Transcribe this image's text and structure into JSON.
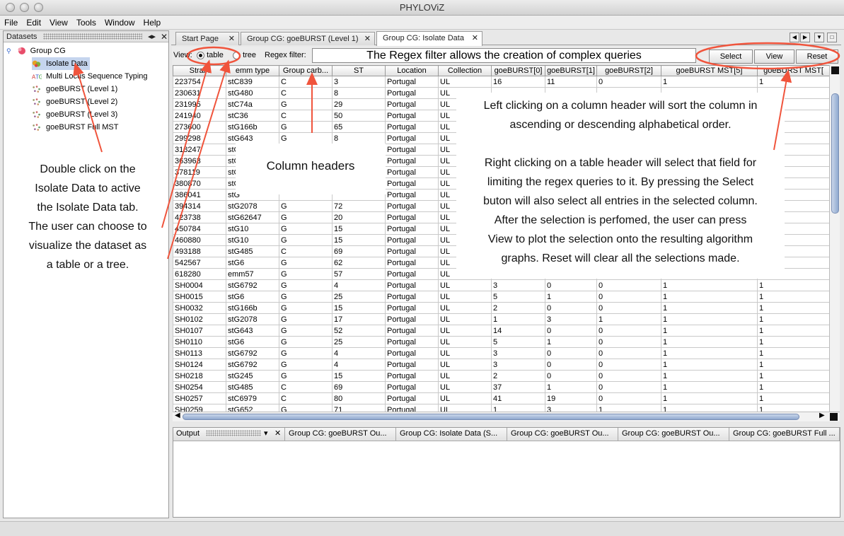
{
  "window": {
    "title": "PHYLOViZ"
  },
  "menu": [
    "File",
    "Edit",
    "View",
    "Tools",
    "Window",
    "Help"
  ],
  "datasets_panel": {
    "title": "Datasets",
    "root": "Group CG",
    "items": [
      {
        "label": "Isolate Data",
        "icon": "isolate-data-icon",
        "selected": true
      },
      {
        "label": "Multi Locus Sequence Typing",
        "icon": "mlst-icon"
      },
      {
        "label": "goeBURST (Level 1)",
        "icon": "goeburst-graph-icon"
      },
      {
        "label": "goeBURST (Level 2)",
        "icon": "goeburst-graph-icon"
      },
      {
        "label": "goeBURST (Level 3)",
        "icon": "goeburst-graph-icon"
      },
      {
        "label": "goeBURST Full MST",
        "icon": "goeburst-graph-icon"
      }
    ]
  },
  "tabs": [
    {
      "label": "Start Page"
    },
    {
      "label": "Group CG: goeBURST (Level 1)"
    },
    {
      "label": "Group CG: Isolate Data",
      "active": true
    }
  ],
  "viewbar": {
    "view_label": "View:",
    "table_label": "table",
    "tree_label": "tree",
    "regex_label": "Regex filter:",
    "regex_value": "The Regex filter allows the creation of complex queries",
    "select_label": "Select",
    "view_button_label": "View",
    "reset_label": "Reset",
    "selected_view": "table"
  },
  "table": {
    "columns": [
      "Strain",
      "emm type",
      "Group carb...",
      "ST",
      "Location",
      "Collection",
      "goeBURST[0]",
      "goeBURST[1]",
      "goeBURST[2]",
      "goeBURST MST[5]",
      "goeBURST MST["
    ],
    "rows": [
      [
        "223754",
        "stC839",
        "C",
        "3",
        "Portugal",
        "UL",
        "16",
        "11",
        "0",
        "1",
        "1"
      ],
      [
        "230631",
        "stG480",
        "C",
        "8",
        "Portugal",
        "UL",
        "",
        "",
        "",
        "",
        ""
      ],
      [
        "231995",
        "stC74a",
        "G",
        "29",
        "Portugal",
        "UL",
        "",
        "",
        "",
        "",
        ""
      ],
      [
        "241940",
        "stC36",
        "C",
        "50",
        "Portugal",
        "UL",
        "",
        "",
        "",
        "",
        ""
      ],
      [
        "273600",
        "stG166b",
        "G",
        "65",
        "Portugal",
        "UL",
        "",
        "",
        "",
        "",
        ""
      ],
      [
        "299298",
        "stG643",
        "G",
        "8",
        "Portugal",
        "UL",
        "",
        "",
        "",
        "",
        ""
      ],
      [
        "318247",
        "stG",
        "",
        "",
        "Portugal",
        "UL",
        "",
        "",
        "",
        "",
        ""
      ],
      [
        "363963",
        "stG",
        "",
        "",
        "Portugal",
        "UL",
        "",
        "",
        "",
        "",
        ""
      ],
      [
        "378119",
        "stG",
        "",
        "",
        "Portugal",
        "UL",
        "",
        "",
        "",
        "",
        ""
      ],
      [
        "380870",
        "stG",
        "",
        "",
        "Portugal",
        "UL",
        "",
        "",
        "",
        "",
        ""
      ],
      [
        "386041",
        "stG",
        "",
        "",
        "Portugal",
        "UL",
        "",
        "",
        "",
        "",
        ""
      ],
      [
        "394314",
        "stG2078",
        "G",
        "72",
        "Portugal",
        "UL",
        "",
        "",
        "",
        "",
        ""
      ],
      [
        "423738",
        "stG62647",
        "G",
        "20",
        "Portugal",
        "UL",
        "",
        "",
        "",
        "",
        ""
      ],
      [
        "450784",
        "stG10",
        "G",
        "15",
        "Portugal",
        "UL",
        "",
        "",
        "",
        "",
        ""
      ],
      [
        "460880",
        "stG10",
        "G",
        "15",
        "Portugal",
        "UL",
        "",
        "",
        "",
        "",
        ""
      ],
      [
        "493188",
        "stG485",
        "C",
        "69",
        "Portugal",
        "UL",
        "",
        "",
        "",
        "",
        ""
      ],
      [
        "542567",
        "stG6",
        "G",
        "62",
        "Portugal",
        "UL",
        "",
        "",
        "",
        "",
        ""
      ],
      [
        "618280",
        "emm57",
        "G",
        "57",
        "Portugal",
        "UL",
        "",
        "",
        "",
        "",
        ""
      ],
      [
        "SH0004",
        "stG6792",
        "G",
        "4",
        "Portugal",
        "UL",
        "3",
        "0",
        "0",
        "1",
        "1"
      ],
      [
        "SH0015",
        "stG6",
        "G",
        "25",
        "Portugal",
        "UL",
        "5",
        "1",
        "0",
        "1",
        "1"
      ],
      [
        "SH0032",
        "stG166b",
        "G",
        "15",
        "Portugal",
        "UL",
        "2",
        "0",
        "0",
        "1",
        "1"
      ],
      [
        "SH0102",
        "stG2078",
        "G",
        "17",
        "Portugal",
        "UL",
        "1",
        "3",
        "1",
        "1",
        "1"
      ],
      [
        "SH0107",
        "stG643",
        "G",
        "52",
        "Portugal",
        "UL",
        "14",
        "0",
        "0",
        "1",
        "1"
      ],
      [
        "SH0110",
        "stG6",
        "G",
        "25",
        "Portugal",
        "UL",
        "5",
        "1",
        "0",
        "1",
        "1"
      ],
      [
        "SH0113",
        "stG6792",
        "G",
        "4",
        "Portugal",
        "UL",
        "3",
        "0",
        "0",
        "1",
        "1"
      ],
      [
        "SH0124",
        "stG6792",
        "G",
        "4",
        "Portugal",
        "UL",
        "3",
        "0",
        "0",
        "1",
        "1"
      ],
      [
        "SH0218",
        "stG245",
        "G",
        "15",
        "Portugal",
        "UL",
        "2",
        "0",
        "0",
        "1",
        "1"
      ],
      [
        "SH0254",
        "stG485",
        "C",
        "69",
        "Portugal",
        "UL",
        "37",
        "1",
        "0",
        "1",
        "1"
      ],
      [
        "SH0257",
        "stC6979",
        "C",
        "80",
        "Portugal",
        "UL",
        "41",
        "19",
        "0",
        "1",
        "1"
      ],
      [
        "SH0259",
        "stG652",
        "G",
        "71",
        "Portugal",
        "UL",
        "1",
        "3",
        "1",
        "1",
        "1"
      ]
    ]
  },
  "annotations": {
    "column_headers": "Column headers",
    "sort_note": [
      "Left clicking on a column header will sort the column in",
      "ascending or descending alphabetical order."
    ],
    "select_note": [
      "Right clicking on a table header will select that field for",
      "limiting the regex queries to it. By pressing the Select",
      "buton will also select all entries in the selected column.",
      "After the selection is perfomed, the user can press",
      "View to plot the selection onto the resulting algorithm",
      "graphs. Reset will clear all the selections made."
    ],
    "left_note": [
      "Double click on the",
      "Isolate Data to active",
      "the Isolate Data tab.",
      "The user can choose to",
      "visualize  the dataset as",
      "a table or a tree."
    ],
    "arrow_color": "#f0543c"
  },
  "output_panel": {
    "title": "Output",
    "tabs": [
      "Group CG: goeBURST Ou...",
      "Group CG: Isolate Data (S...",
      "Group CG: goeBURST Ou...",
      "Group CG: goeBURST Ou...",
      "Group CG: goeBURST Full ..."
    ]
  }
}
